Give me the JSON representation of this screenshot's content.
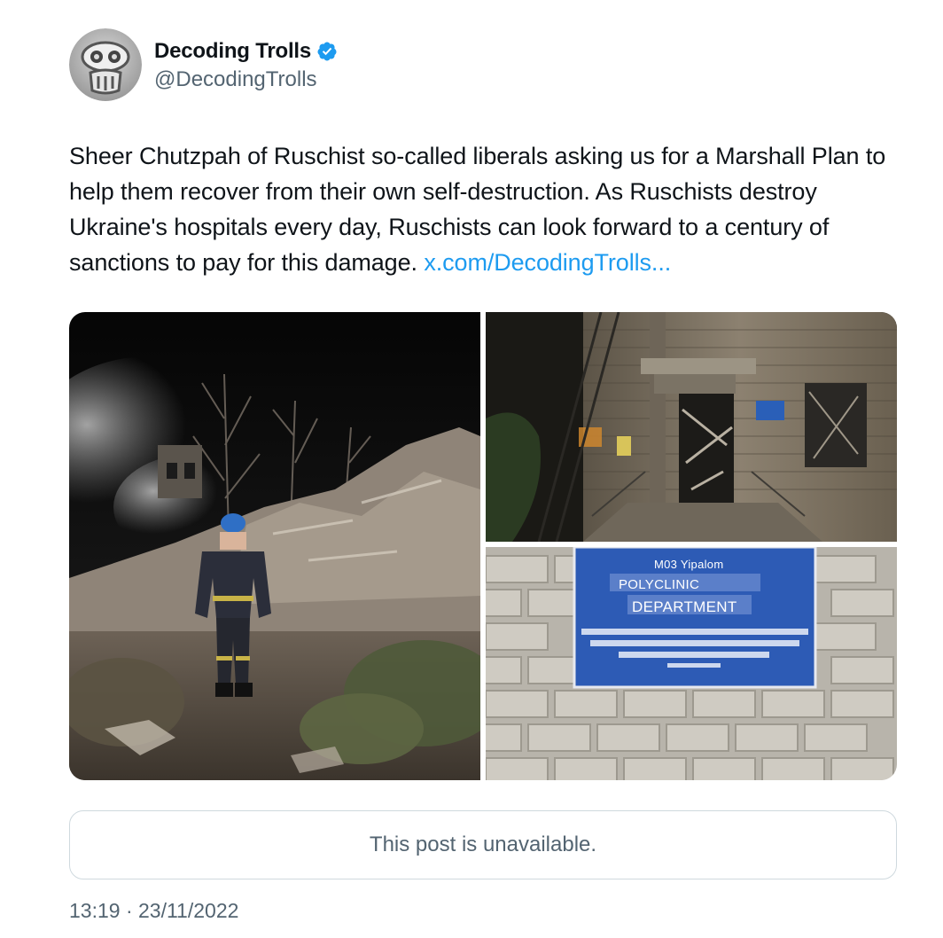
{
  "author": {
    "display_name": "Decoding Trolls",
    "handle": "@DecodingTrolls",
    "verified": true,
    "avatar_icon": "troll-mask-icon"
  },
  "tweet": {
    "text": "Sheer Chutzpah of Ruschist so-called liberals asking us for a Marshall Plan to help them recover from their own self-destruction. As Ruschists destroy Ukraine's hospitals every day, Ruschists can look forward to a century of sanctions to pay for this damage. ",
    "link_text": "x.com/DecodingTrolls..."
  },
  "media": {
    "sign": {
      "top": "M03 Yipalom",
      "line1": "POLYCLINIC",
      "line2": "DEPARTMENT"
    }
  },
  "quote": {
    "unavailable_text": "This post is unavailable."
  },
  "timestamp": "13:19 · 23/11/2022",
  "colors": {
    "link": "#1d9bf0",
    "verified": "#1d9bf0",
    "secondary_text": "#536471",
    "border": "#cfd9de"
  }
}
